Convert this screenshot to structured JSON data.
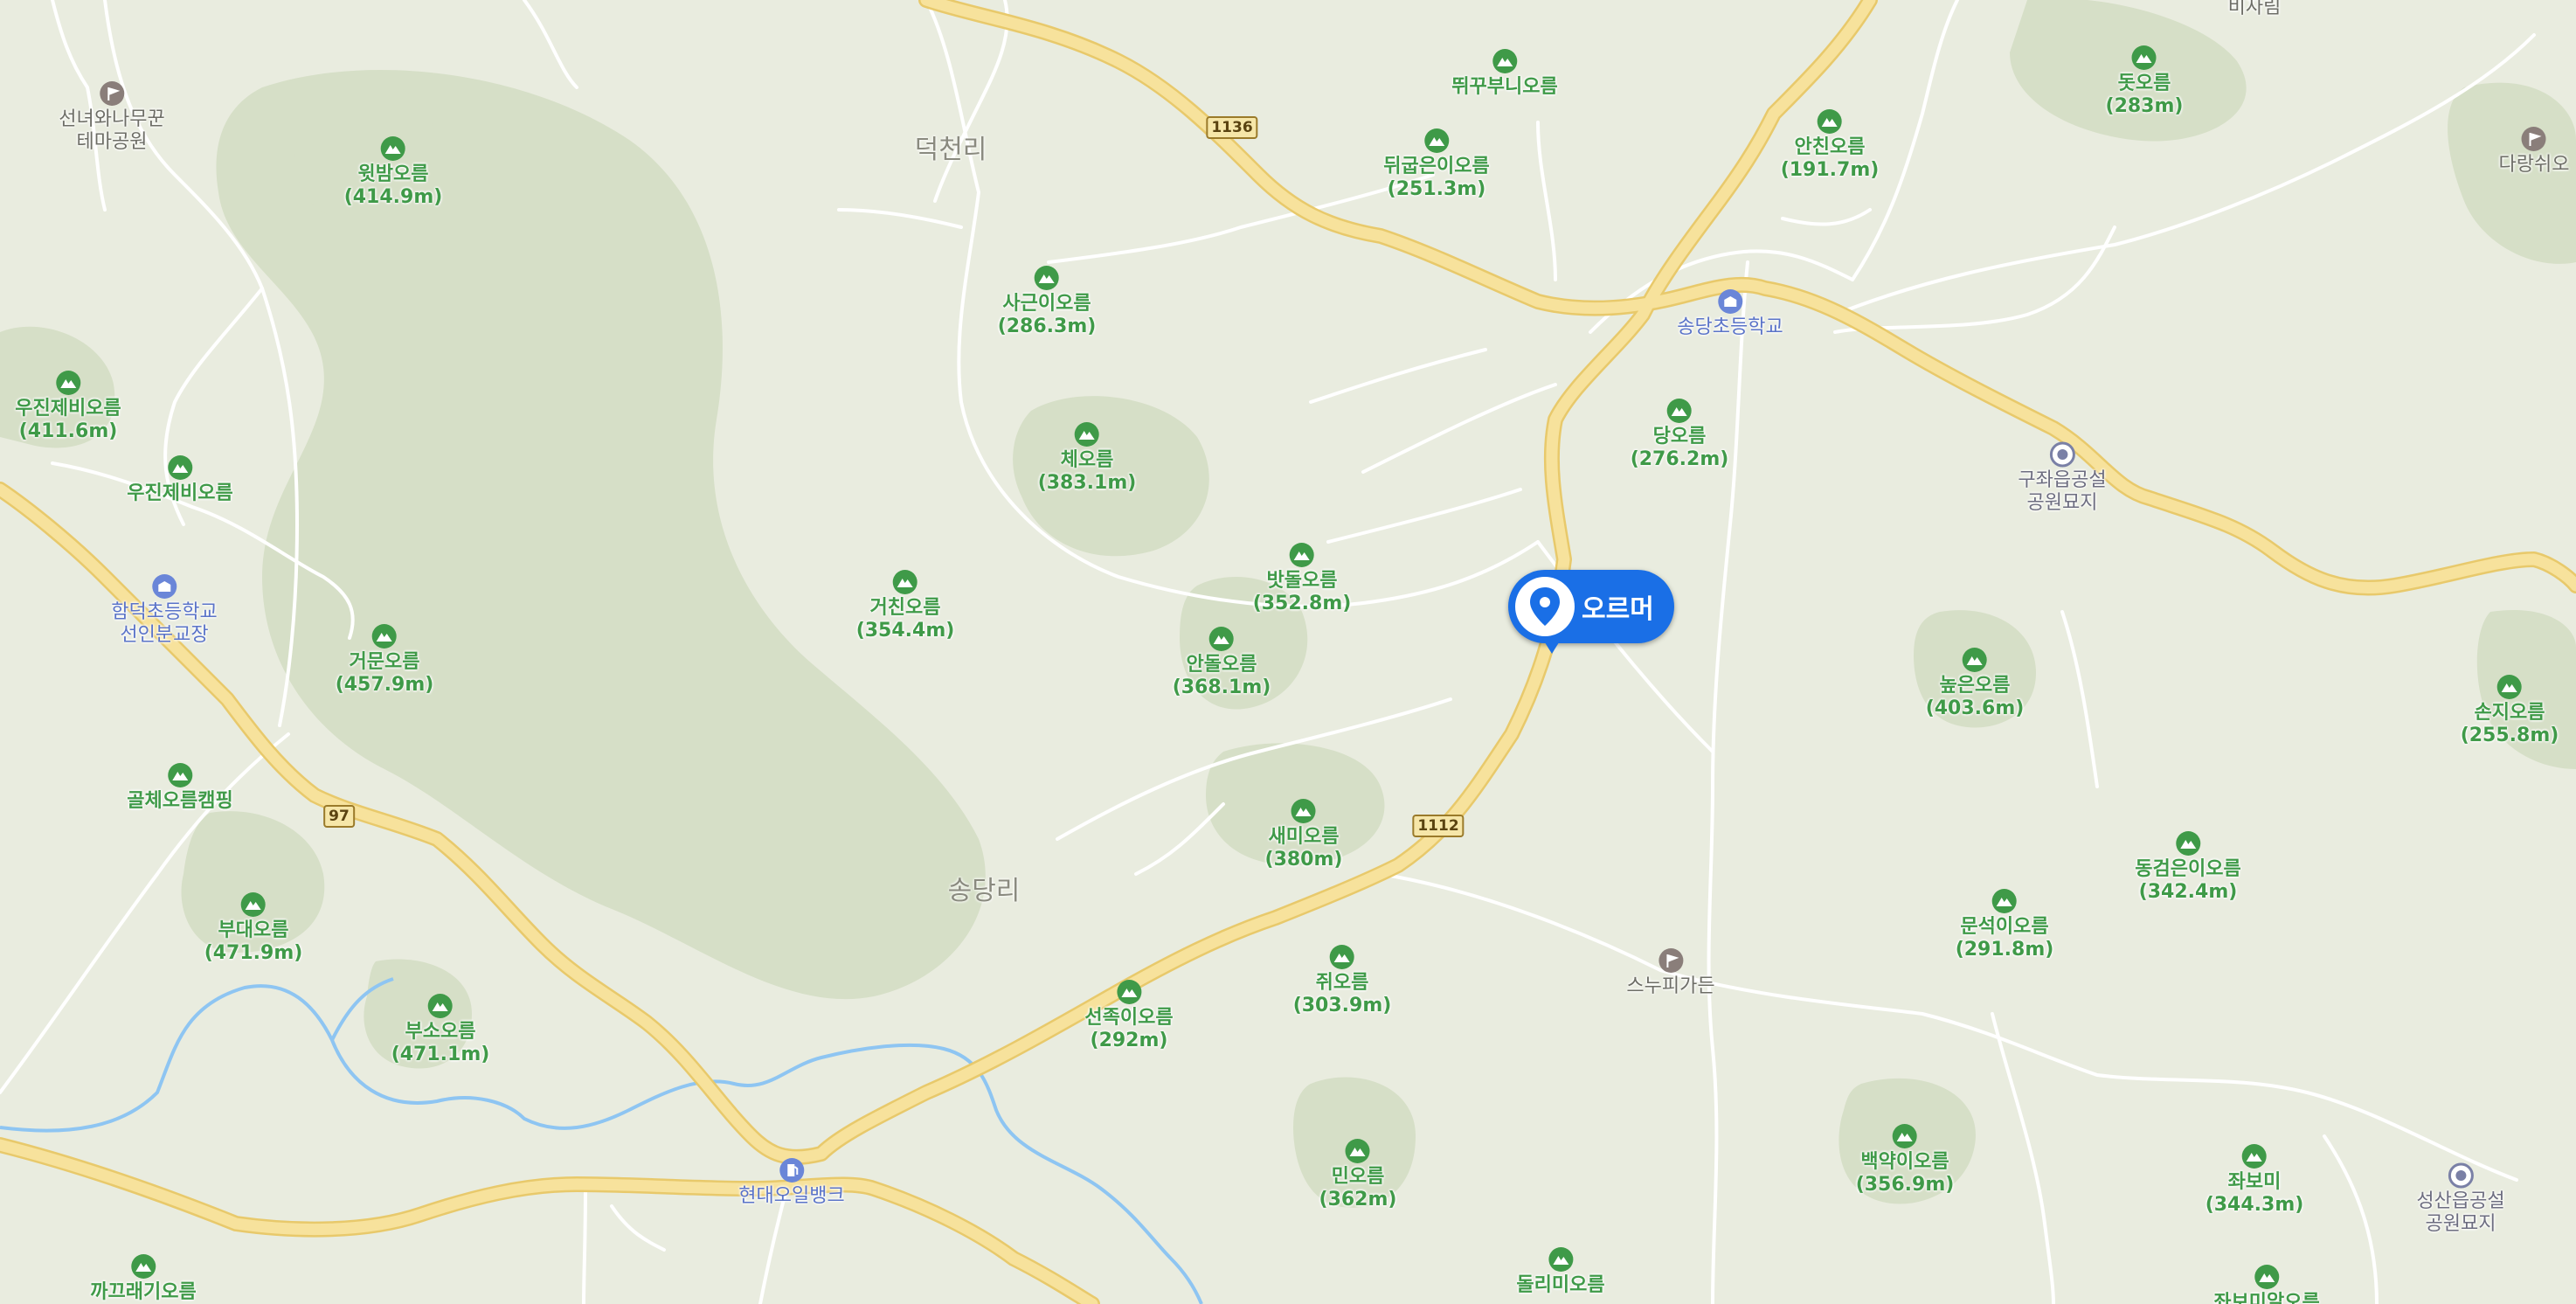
{
  "map": {
    "marker_label": "오르머",
    "colors": {
      "land": "#e9ecdf",
      "forest": "#d4ddc4",
      "forest_dark": "#c8d4b6",
      "main_road": "#f7e29c",
      "main_road_edge": "#e8c96b",
      "minor_road": "#ffffff",
      "stream": "#8ec5f2",
      "peak_text": "#3f9a48",
      "marker": "#1a6fe6"
    },
    "routes": [
      "1136",
      "1112",
      "97"
    ],
    "villages": [
      "덕천리",
      "송당리"
    ],
    "peaks": [
      {
        "name": "윗밤오름",
        "elev": "(414.9m)"
      },
      {
        "name": "뛰꾸부니오름",
        "elev": ""
      },
      {
        "name": "돗오름",
        "elev": "(283m)"
      },
      {
        "name": "뒤굽은이오름",
        "elev": "(251.3m)"
      },
      {
        "name": "안친오름",
        "elev": "(191.7m)"
      },
      {
        "name": "사근이오름",
        "elev": "(286.3m)"
      },
      {
        "name": "우진제비오름",
        "elev": "(411.6m)"
      },
      {
        "name": "우진제비오름",
        "elev": ""
      },
      {
        "name": "체오름",
        "elev": "(383.1m)"
      },
      {
        "name": "당오름",
        "elev": "(276.2m)"
      },
      {
        "name": "밧돌오름",
        "elev": "(352.8m)"
      },
      {
        "name": "거친오름",
        "elev": "(354.4m)"
      },
      {
        "name": "안돌오름",
        "elev": "(368.1m)"
      },
      {
        "name": "거문오름",
        "elev": "(457.9m)"
      },
      {
        "name": "높은오름",
        "elev": "(403.6m)"
      },
      {
        "name": "손지오름",
        "elev": "(255.8m)"
      },
      {
        "name": "골체오름캠핑",
        "elev": ""
      },
      {
        "name": "새미오름",
        "elev": "(380m)"
      },
      {
        "name": "동검은이오름",
        "elev": "(342.4m)"
      },
      {
        "name": "부대오름",
        "elev": "(471.9m)"
      },
      {
        "name": "문석이오름",
        "elev": "(291.8m)"
      },
      {
        "name": "선족이오름",
        "elev": "(292m)"
      },
      {
        "name": "쥐오름",
        "elev": "(303.9m)"
      },
      {
        "name": "부소오름",
        "elev": "(471.1m)"
      },
      {
        "name": "민오름",
        "elev": "(362m)"
      },
      {
        "name": "백약이오름",
        "elev": "(356.9m)"
      },
      {
        "name": "좌보미",
        "elev": "(344.3m)"
      },
      {
        "name": "돌리미오름",
        "elev": ""
      },
      {
        "name": "까끄래기오름",
        "elev": ""
      },
      {
        "name": "좌보미알오름",
        "elev": ""
      }
    ],
    "pois": [
      {
        "name": "선녀와나무꾼\n테마공원",
        "kind": "flag"
      },
      {
        "name": "함덕초등학교\n선인분교장",
        "kind": "school"
      },
      {
        "name": "송당초등학교",
        "kind": "school"
      },
      {
        "name": "구좌읍공설\n공원묘지",
        "kind": "cemetery"
      },
      {
        "name": "스누피가든",
        "kind": "flag"
      },
      {
        "name": "현대오일뱅크",
        "kind": "fuel"
      },
      {
        "name": "성산읍공설\n공원묘지",
        "kind": "cemetery"
      },
      {
        "name": "다랑쉬오",
        "kind": "flag"
      },
      {
        "name": "비자림",
        "kind": "park"
      }
    ]
  }
}
